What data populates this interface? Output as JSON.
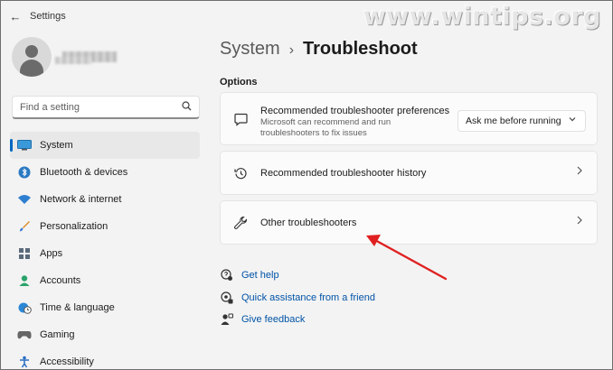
{
  "window": {
    "title": "Settings",
    "watermark": "www.wintips.org"
  },
  "titlebar": {
    "back_icon": "back-arrow-icon"
  },
  "profile": {
    "avatar_icon": "user-avatar-icon"
  },
  "search": {
    "placeholder": "Find a setting",
    "value": "",
    "icon": "search-icon"
  },
  "sidebar": {
    "items": [
      {
        "label": "System",
        "icon": "system-icon",
        "active": true
      },
      {
        "label": "Bluetooth & devices",
        "icon": "bluetooth-icon"
      },
      {
        "label": "Network & internet",
        "icon": "wifi-icon"
      },
      {
        "label": "Personalization",
        "icon": "brush-icon"
      },
      {
        "label": "Apps",
        "icon": "apps-icon"
      },
      {
        "label": "Accounts",
        "icon": "accounts-icon"
      },
      {
        "label": "Time & language",
        "icon": "clock-globe-icon"
      },
      {
        "label": "Gaming",
        "icon": "gamepad-icon"
      },
      {
        "label": "Accessibility",
        "icon": "accessibility-icon"
      }
    ]
  },
  "main": {
    "breadcrumb_parent": "System",
    "breadcrumb_separator": "›",
    "title": "Troubleshoot",
    "section_label": "Options",
    "cards": [
      {
        "title": "Recommended troubleshooter preferences",
        "description": "Microsoft can recommend and run troubleshooters to fix issues",
        "icon": "chat-bubble-icon",
        "dropdown_value": "Ask me before running"
      },
      {
        "title": "Recommended troubleshooter history",
        "icon": "history-icon"
      },
      {
        "title": "Other troubleshooters",
        "icon": "wrench-icon"
      }
    ],
    "links": [
      {
        "label": "Get help",
        "icon": "help-icon"
      },
      {
        "label": "Quick assistance from a friend",
        "icon": "quick-assist-icon"
      },
      {
        "label": "Give feedback",
        "icon": "feedback-icon"
      }
    ]
  },
  "colors": {
    "accent": "#0067c0",
    "link": "#0053a6",
    "annotation_arrow": "#e02020"
  }
}
